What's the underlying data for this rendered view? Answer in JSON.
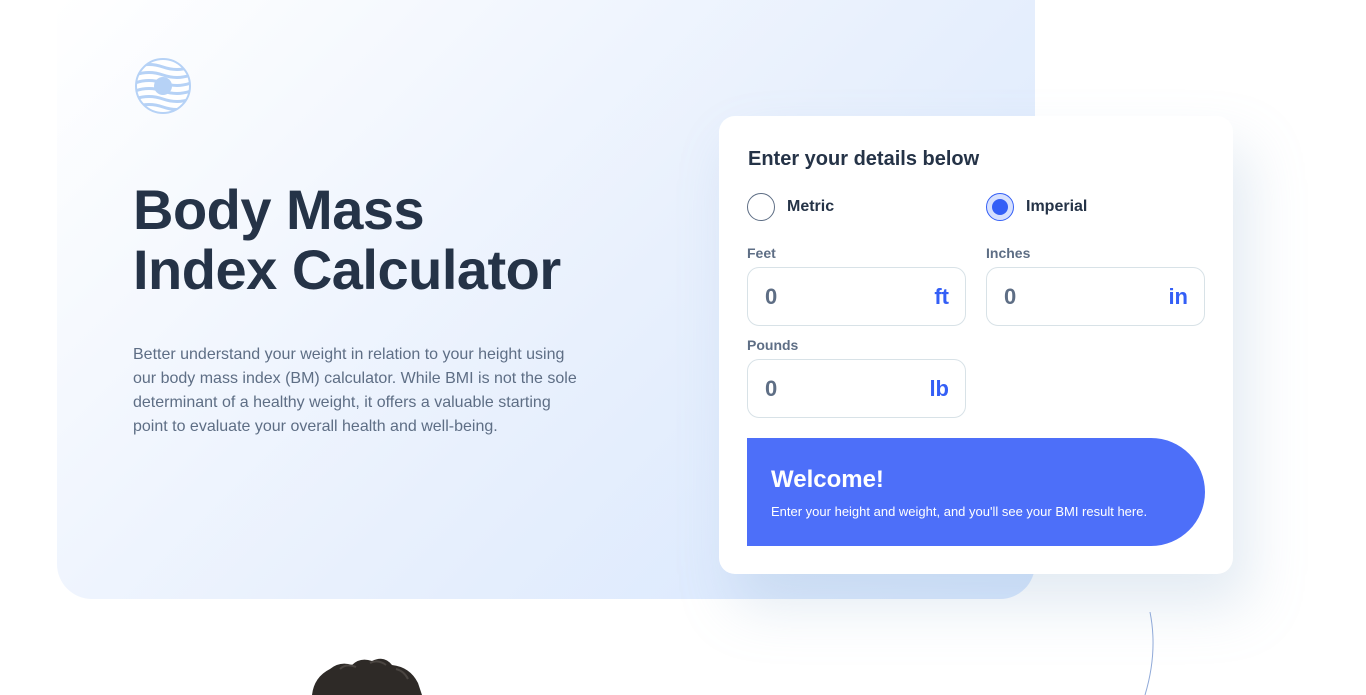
{
  "header": {
    "logo_icon": "bmi-logo-icon",
    "title_line1": "Body Mass",
    "title_line2": "Index Calculator",
    "intro": "Better understand your weight in relation to your height using our body mass index (BM) calculator. While BMI is not the sole determinant of a healthy weight, it offers a valuable starting point to evaluate your overall health and well-being."
  },
  "form": {
    "heading": "Enter your details below",
    "units": [
      {
        "label": "Metric",
        "checked": false
      },
      {
        "label": "Imperial",
        "checked": true
      }
    ],
    "feet": {
      "label": "Feet",
      "placeholder": "0",
      "unit": "ft"
    },
    "inches": {
      "label": "Inches",
      "placeholder": "0",
      "unit": "in"
    },
    "pounds": {
      "label": "Pounds",
      "placeholder": "0",
      "unit": "lb"
    }
  },
  "result": {
    "title": "Welcome!",
    "text": "Enter your height and weight, and you'll see your BMI result here."
  },
  "colors": {
    "accent": "#345ff6",
    "result_bg": "#4d6ff9",
    "heading": "#253347",
    "body_text": "#5e6e85",
    "hero_gradient_end": "#d6e6fe"
  }
}
